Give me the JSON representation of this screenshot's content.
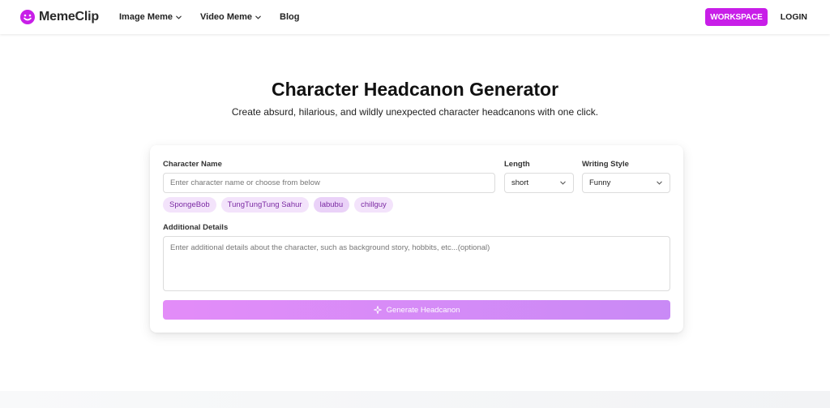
{
  "brand": {
    "name": "MemeClip",
    "color": "#c81ee8"
  },
  "nav": {
    "items": [
      {
        "label": "Image Meme",
        "has_dropdown": true
      },
      {
        "label": "Video Meme",
        "has_dropdown": true
      },
      {
        "label": "Blog",
        "has_dropdown": false
      }
    ],
    "workspace_label": "WORKSPACE",
    "login_label": "LOGIN"
  },
  "hero": {
    "title": "Character Headcanon Generator",
    "subtitle": "Create absurd, hilarious, and wildly unexpected character headcanons with one click."
  },
  "form": {
    "character_name": {
      "label": "Character Name",
      "placeholder": "Enter character name or choose from below",
      "value": ""
    },
    "length": {
      "label": "Length",
      "value": "short"
    },
    "writing_style": {
      "label": "Writing Style",
      "value": "Funny"
    },
    "suggestions": [
      "SpongeBob",
      "TungTungTung Sahur",
      "labubu",
      "chillguy"
    ],
    "additional_details": {
      "label": "Additional Details",
      "placeholder": "Enter additional details about the character, such as background story, hobbits, etc...(optional)"
    },
    "generate_label": "Generate Headcanon"
  },
  "icons": {
    "logo": "smiley-face-icon",
    "dropdown": "chevron-down-icon",
    "generate": "sparkle-icon"
  }
}
